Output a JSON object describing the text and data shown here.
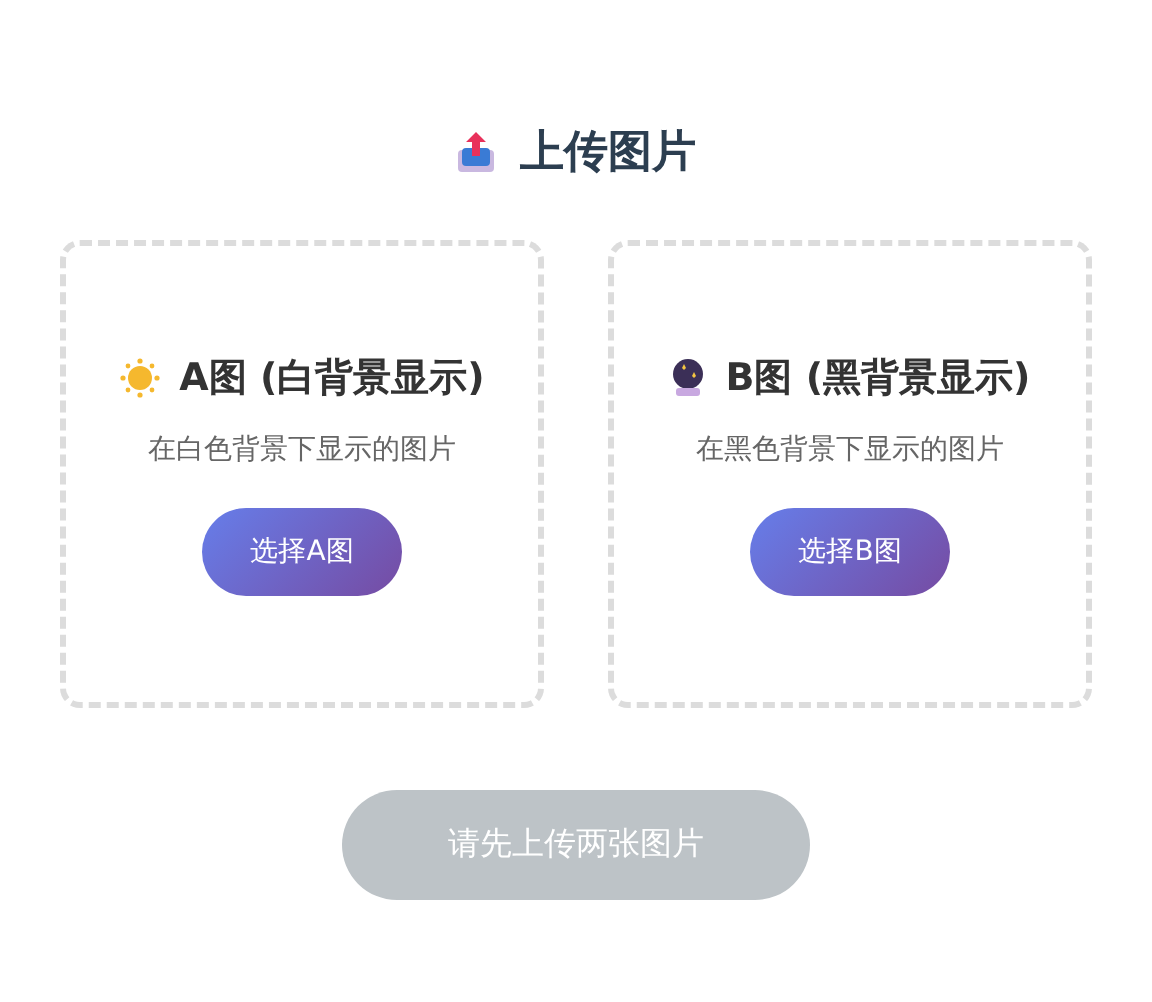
{
  "title": "上传图片",
  "cards": [
    {
      "kind": "sun",
      "heading": "A图 (白背景显示)",
      "description": "在白色背景下显示的图片",
      "button": "选择A图"
    },
    {
      "kind": "ball",
      "heading": "B图 (黑背景显示)",
      "description": "在黑色背景下显示的图片",
      "button": "选择B图"
    }
  ],
  "submit": {
    "label": "请先上传两张图片",
    "disabled": true
  }
}
